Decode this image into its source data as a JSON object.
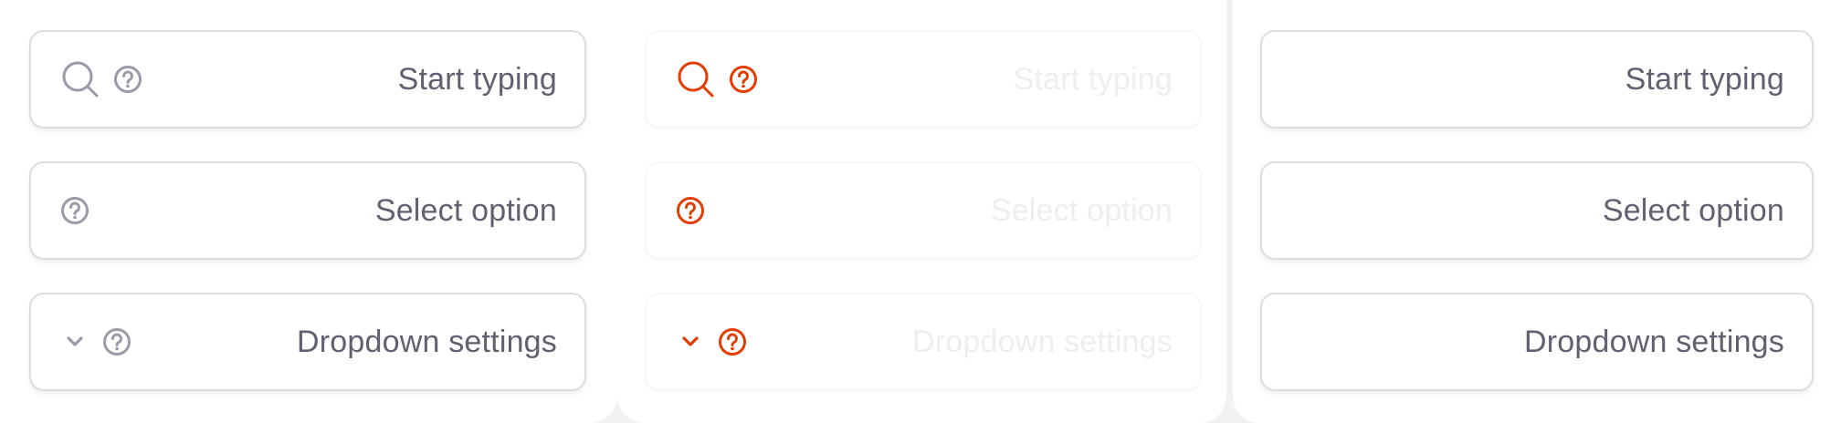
{
  "colors": {
    "icon_default": "#9a9aa8",
    "icon_accent": "#e23c00",
    "text": "#5f6170",
    "text_ghost": "#eeeef1",
    "border": "#dcdce2"
  },
  "columns": [
    {
      "variant": "default",
      "fields": [
        {
          "label": "Start typing",
          "icons": [
            "search-icon",
            "help-circle-icon"
          ]
        },
        {
          "label": "Select option",
          "icons": [
            "help-circle-icon"
          ]
        },
        {
          "label": "Dropdown settings",
          "icons": [
            "chevron-down-icon",
            "help-circle-icon"
          ]
        }
      ]
    },
    {
      "variant": "disabled-accent",
      "fields": [
        {
          "label": "Start typing",
          "icons": [
            "search-icon",
            "help-circle-icon"
          ]
        },
        {
          "label": "Select option",
          "icons": [
            "help-circle-icon"
          ]
        },
        {
          "label": "Dropdown settings",
          "icons": [
            "chevron-down-icon",
            "help-circle-icon"
          ]
        }
      ]
    },
    {
      "variant": "no-icons",
      "fields": [
        {
          "label": "Start typing",
          "icons": []
        },
        {
          "label": "Select option",
          "icons": []
        },
        {
          "label": "Dropdown settings",
          "icons": []
        }
      ]
    }
  ]
}
